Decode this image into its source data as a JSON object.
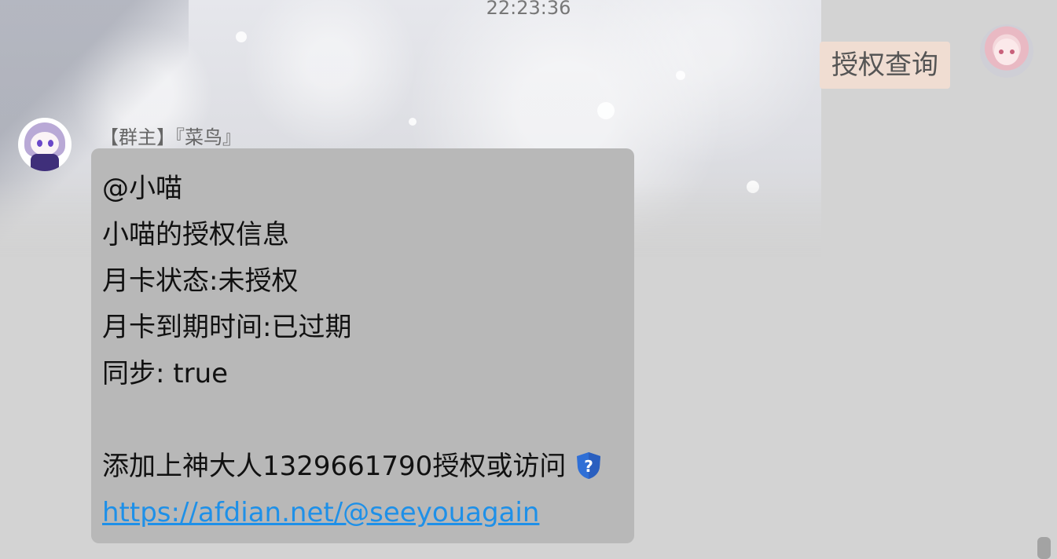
{
  "header": {
    "timestamp": "22:23:36"
  },
  "messages": {
    "outgoing": {
      "text": "授权查询",
      "avatar_icon": "user-avatar-icon"
    },
    "incoming": {
      "sender": "【群主】『菜鸟』",
      "avatar_icon": "bot-avatar-icon",
      "lines": [
        "@小喵",
        "小喵的授权信息",
        "月卡状态:未授权",
        "月卡到期时间:已过期",
        "同步: true",
        "",
        "添加上神大人1329661790授权或访问"
      ],
      "link": "https://afdian.net/@seeyouagain",
      "inline_icon": "question-shield-icon"
    }
  },
  "colors": {
    "background": "#d3d3d3",
    "incoming_bubble": "#b8b8b8",
    "outgoing_bubble": "#f0ddd2",
    "link": "#1e90e8"
  }
}
